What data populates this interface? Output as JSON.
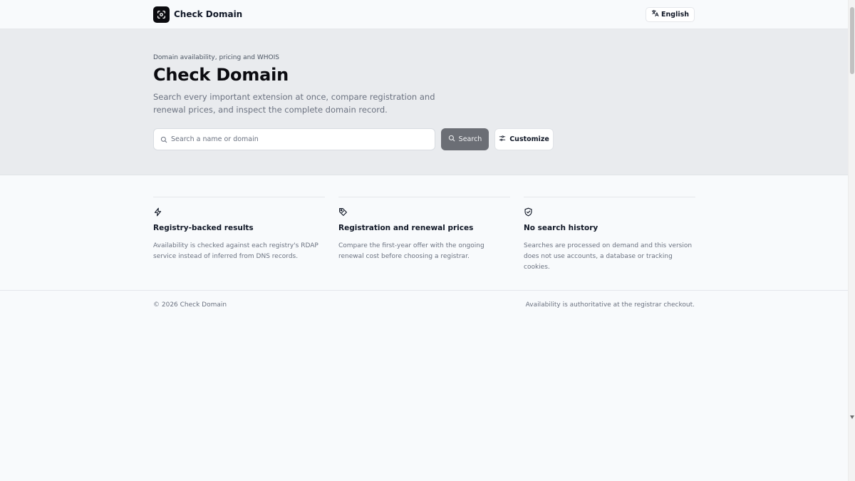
{
  "nav": {
    "brand_name": "Check Domain",
    "logo_icon": "scan-icon",
    "language_label": "English",
    "language_icon": "translate-icon"
  },
  "hero": {
    "eyebrow": "Domain availability, pricing and WHOIS",
    "title": "Check Domain",
    "description": "Search every important extension at once, compare registration and renewal prices, and inspect the complete domain record.",
    "search_placeholder": "Search a name or domain",
    "search_value": "",
    "search_button": "Search",
    "customize_button": "Customize"
  },
  "features": [
    {
      "icon": "lightning-icon",
      "title": "Registry-backed results",
      "description": "Availability is checked against each registry's RDAP service instead of inferred from DNS records."
    },
    {
      "icon": "price-tag-icon",
      "title": "Registration and renewal prices",
      "description": "Compare the first-year offer with the ongoing renewal cost before choosing a registrar."
    },
    {
      "icon": "shield-check-icon",
      "title": "No search history",
      "description": "Searches are processed on demand and this version does not use accounts, a database or tracking cookies."
    }
  ],
  "footer": {
    "copyright": "© 2026 Check Domain",
    "note": "Availability is authoritative at the registrar checkout."
  },
  "colors": {
    "hero_bg": "#e9ebee",
    "page_bg": "#f8fafc",
    "search_button_bg": "#6b6e75",
    "logo_bg": "#0b0b0f"
  }
}
